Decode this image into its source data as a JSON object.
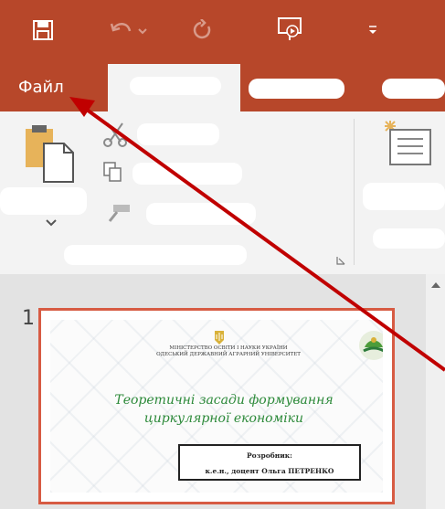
{
  "app": {
    "title_bar_color": "#b7472a",
    "accent_color": "#d75b43",
    "annotation_arrow_color": "#c00000"
  },
  "tabs": {
    "file": "Файл"
  },
  "quick_access": {
    "icons": [
      "save-icon",
      "undo-icon",
      "redo-icon",
      "present-from-start-icon",
      "customize-qat-icon"
    ]
  },
  "slides": [
    {
      "number": "1",
      "ministry_text": "МІНІСТЕРСТВО ОСВІТИ І НАУКИ УКРАЇНИ\nОДЕСЬКИЙ ДЕРЖАВНИЙ АГРАРНИЙ УНІВЕРСИТЕТ",
      "title_line1": "Теоретичні засади формування",
      "title_line2": "циркулярної економіки",
      "author_label": "Розробник:",
      "author_name": "к.е.н., доцент Ольга ПЕТРЕНКО"
    }
  ]
}
